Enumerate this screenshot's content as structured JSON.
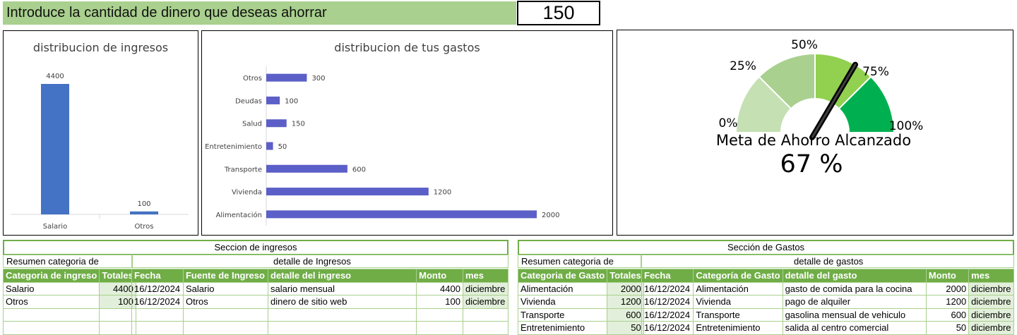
{
  "header": {
    "prompt": "Introduce la cantidad de dinero que deseas ahorrar",
    "savings_value": "150"
  },
  "chart_data": [
    {
      "type": "bar",
      "title": "distribucion de ingresos",
      "categories": [
        "Salario",
        "Otros"
      ],
      "values": [
        4400,
        100
      ],
      "color": "#4472c4"
    },
    {
      "type": "bar",
      "orientation": "horizontal",
      "title": "distribucion de tus gastos",
      "categories": [
        "Otros",
        "Deudas",
        "Salud",
        "Entretenimiento",
        "Transporte",
        "Vivienda",
        "Alimentación"
      ],
      "values": [
        300,
        100,
        150,
        50,
        600,
        1200,
        2000
      ],
      "color": "#5b5fc7"
    },
    {
      "type": "gauge",
      "title": "Meta de Ahorro Alcanzado",
      "value_label": "67 %",
      "value": 67,
      "tick_labels": [
        "0%",
        "25%",
        "50%",
        "75%",
        "100%"
      ],
      "colors": [
        "#c5e0b3",
        "#a9d08e",
        "#92d050",
        "#00b050"
      ]
    }
  ],
  "ingresos": {
    "section_title": "Seccion de ingresos",
    "summary_title": "Resumen categoria de ingreso",
    "detail_title": "detalle de Ingresos",
    "summary_headers": [
      "Categoria de ingreso",
      "Totales"
    ],
    "summary_rows": [
      [
        "Salario",
        "4400"
      ],
      [
        "Otros",
        "100"
      ]
    ],
    "detail_headers": [
      "Fecha",
      "Fuente de Ingreso",
      "detalle del ingreso",
      "Monto",
      "mes"
    ],
    "detail_rows": [
      [
        "16/12/2024",
        "Salario",
        "salario mensual",
        "4400",
        "diciembre"
      ],
      [
        "16/12/2024",
        "Otros",
        "dinero de sitio web",
        "100",
        "diciembre"
      ]
    ]
  },
  "gastos": {
    "section_title": "Sección de Gastos",
    "summary_title": "Resumen categoria de Gasto",
    "detail_title": "detalle de gastos",
    "summary_headers": [
      "Categoria de Gasto",
      "Totales"
    ],
    "summary_rows": [
      [
        "Alimentación",
        "2000"
      ],
      [
        "Vivienda",
        "1200"
      ],
      [
        "Transporte",
        "600"
      ],
      [
        "Entretenimiento",
        "50"
      ]
    ],
    "detail_headers": [
      "Fecha",
      "Categoría de Gasto",
      "detalle del gasto",
      "Monto",
      "mes"
    ],
    "detail_rows": [
      [
        "16/12/2024",
        "Alimentación",
        "gasto de comida para la cocina",
        "2000",
        "diciembre"
      ],
      [
        "16/12/2024",
        "Vivienda",
        "pago de alquiler",
        "1200",
        "diciembre"
      ],
      [
        "16/12/2024",
        "Transporte",
        "gasolina mensual de vehiculo",
        "600",
        "diciembre"
      ],
      [
        "16/12/2024",
        "Entretenimiento",
        "salida al centro comercial",
        "50",
        "diciembre"
      ]
    ]
  }
}
